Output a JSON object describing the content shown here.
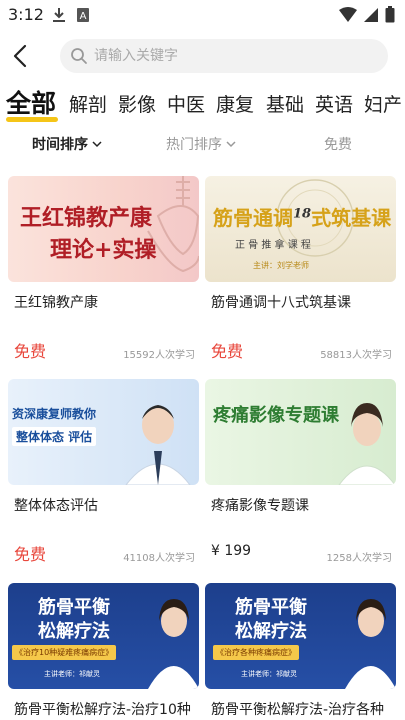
{
  "status_bar": {
    "time": "3:12",
    "icons": [
      "download-icon",
      "a-badge-icon",
      "wifi-icon",
      "cell-signal-icon",
      "battery-icon"
    ]
  },
  "search": {
    "placeholder": "请输入关键字",
    "value": ""
  },
  "category_tabs": [
    {
      "label": "全部",
      "active": true
    },
    {
      "label": "解剖",
      "active": false
    },
    {
      "label": "影像",
      "active": false
    },
    {
      "label": "中医",
      "active": false
    },
    {
      "label": "康复",
      "active": false
    },
    {
      "label": "基础",
      "active": false
    },
    {
      "label": "英语",
      "active": false
    },
    {
      "label": "妇产",
      "active": false
    }
  ],
  "sort": {
    "time": "时间排序",
    "hot": "热门排序",
    "free": "免费"
  },
  "courses": [
    {
      "title": "王红锦教产康",
      "price": "免费",
      "learners": "15592人次学习",
      "thumb_text": {
        "line1": "王红锦教产康",
        "line2": "理论+实操"
      }
    },
    {
      "title": "筋骨通调十八式筑基课",
      "price": "免费",
      "learners": "58813人次学习",
      "thumb_text": {
        "line1": "筋骨通调",
        "num": "18",
        "line1b": "式筑基课",
        "line2": "正 骨 推 拿 课 程",
        "line3": "主讲：刘学老师"
      }
    },
    {
      "title": "整体体态评估",
      "price": "免费",
      "learners": "41108人次学习",
      "thumb_text": {
        "line1": "资深康复师教你",
        "line2": "整体体态 评估"
      }
    },
    {
      "title": "疼痛影像专题课",
      "price": "¥ 199",
      "learners": "1258人次学习",
      "thumb_text": {
        "line1": "疼痛影像专题课"
      }
    },
    {
      "title": "筋骨平衡松解疗法-治疗10种",
      "thumb_text": {
        "line1": "筋骨平衡",
        "line2": "松解疗法",
        "line3": "《治疗10种疑难疼痛病症》",
        "line4": "主讲老师：祁献灵"
      }
    },
    {
      "title": "筋骨平衡松解疗法-治疗各种",
      "thumb_text": {
        "line1": "筋骨平衡",
        "line2": "松解疗法",
        "line3": "《治疗各种疼痛病症》",
        "line4": "主讲老师：祁献灵"
      }
    }
  ],
  "colors": {
    "accent_yellow": "#f5c518",
    "price_red": "#e8473c",
    "muted_gray": "#999999"
  }
}
